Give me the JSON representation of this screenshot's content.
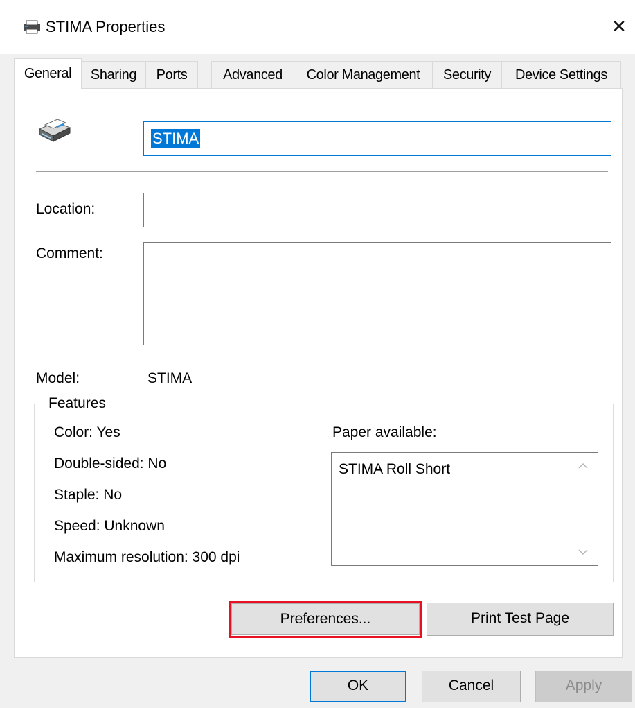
{
  "window": {
    "title": "STIMA Properties",
    "title_icon": "printer-icon",
    "close_glyph": "✕"
  },
  "tabs": [
    {
      "label": "General",
      "active": true
    },
    {
      "label": "Sharing",
      "active": false
    },
    {
      "label": "Ports",
      "active": false
    },
    {
      "label": "Advanced",
      "active": false
    },
    {
      "label": "Color Management",
      "active": false
    },
    {
      "label": "Security",
      "active": false
    },
    {
      "label": "Device Settings",
      "active": false
    }
  ],
  "general": {
    "printer_name": "STIMA",
    "location_label": "Location:",
    "location_value": "",
    "comment_label": "Comment:",
    "comment_value": "",
    "model_label": "Model:",
    "model_value": "STIMA"
  },
  "features": {
    "legend": "Features",
    "color": "Color: Yes",
    "double_sided": "Double-sided: No",
    "staple": "Staple: No",
    "speed": "Speed: Unknown",
    "max_resolution": "Maximum resolution: 300 dpi",
    "paper_label": "Paper available:",
    "paper_items": [
      "STIMA Roll Short"
    ]
  },
  "buttons": {
    "preferences": "Preferences...",
    "print_test_page": "Print Test Page",
    "ok": "OK",
    "cancel": "Cancel",
    "apply": "Apply"
  },
  "colors": {
    "accent": "#0078d7",
    "highlight": "#e81123",
    "window_bg": "#f0f0f0"
  }
}
